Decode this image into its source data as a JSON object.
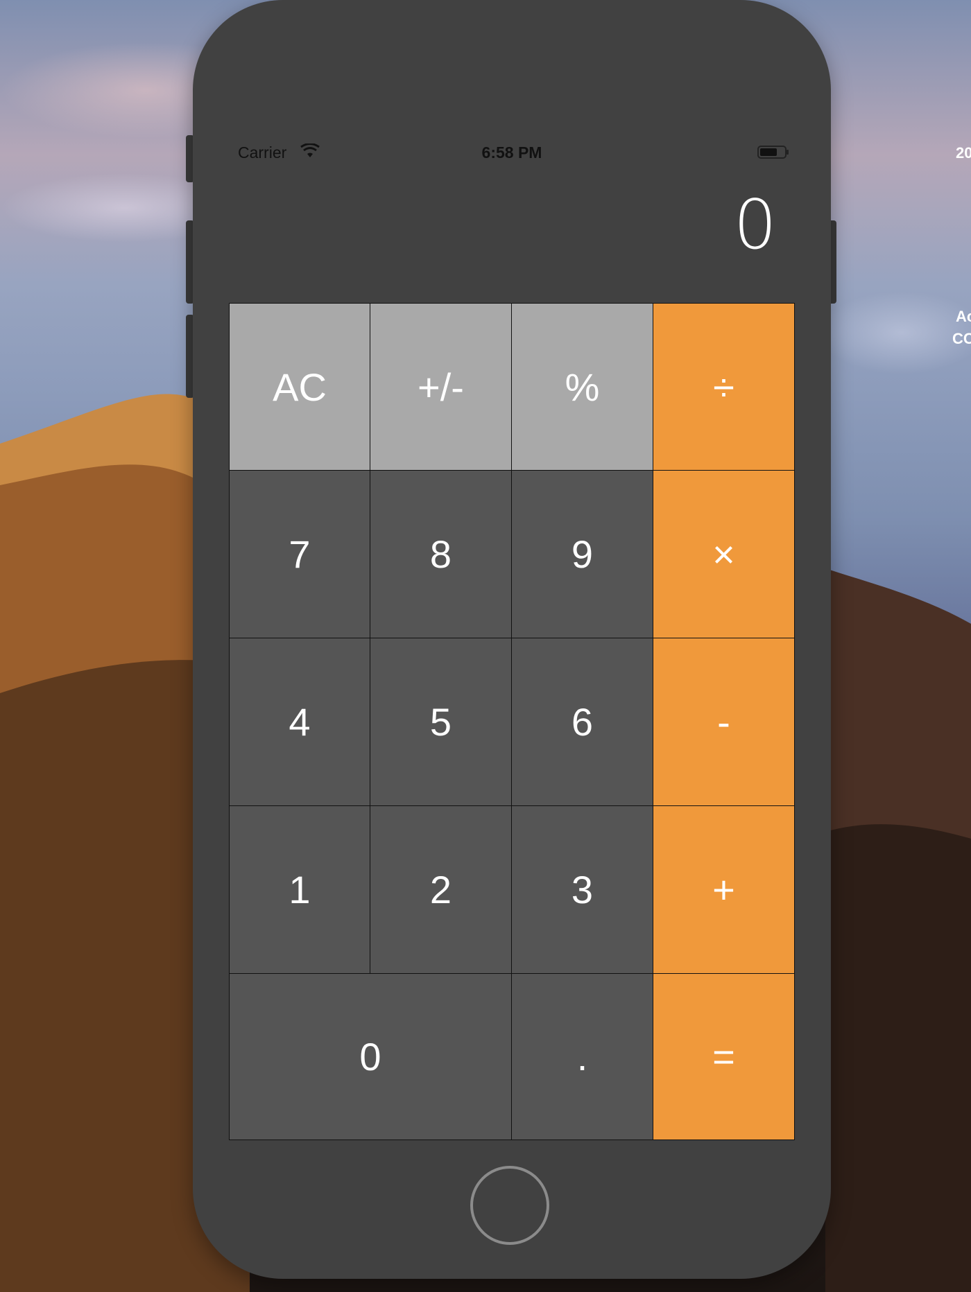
{
  "status_bar": {
    "carrier": "Carrier",
    "time": "6:58 PM"
  },
  "display": {
    "value": "0"
  },
  "keys": {
    "row1": [
      "AC",
      "+/-",
      "%",
      "÷"
    ],
    "row2": [
      "7",
      "8",
      "9",
      "×"
    ],
    "row3": [
      "4",
      "5",
      "6",
      "-"
    ],
    "row4": [
      "1",
      "2",
      "3",
      "+"
    ],
    "row5": [
      "0",
      ".",
      "="
    ]
  },
  "desktop": {
    "text_top": "20",
    "text_mid1": "Ac",
    "text_mid2": "CC"
  },
  "colors": {
    "function_key": "#a9a9a9",
    "number_key": "#555555",
    "operator_key": "#f0993b",
    "phone_body": "#414141"
  },
  "icons": [
    "wifi-icon",
    "battery-icon",
    "home-button"
  ]
}
